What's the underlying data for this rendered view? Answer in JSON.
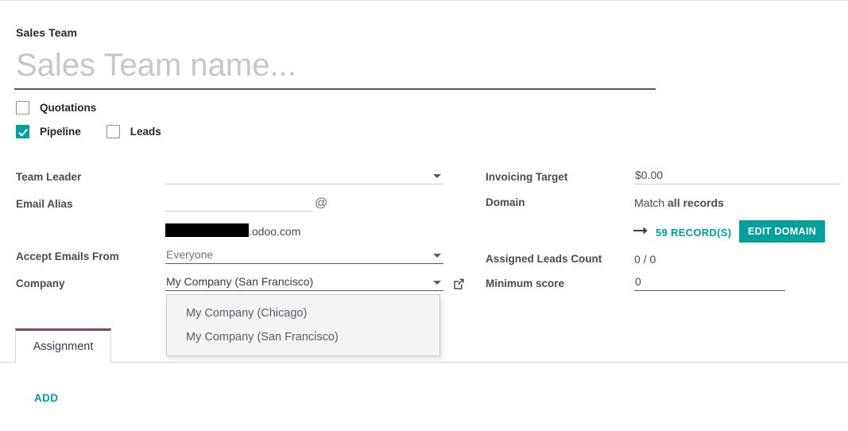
{
  "theme": {
    "accent_teal": "#00a09d",
    "brand_purple": "#714b67",
    "text": "#4c4c4c",
    "heading": "#23282d"
  },
  "form": {
    "title_label": "Sales Team",
    "name_placeholder": "Sales Team name...",
    "name_value": ""
  },
  "options": [
    {
      "label": "Quotations",
      "checked": false
    },
    {
      "label": "Pipeline",
      "checked": true
    },
    {
      "label": "Leads",
      "checked": false
    }
  ],
  "left_fields": {
    "team_leader": {
      "label": "Team Leader",
      "value": "",
      "placeholder": ""
    },
    "email_alias": {
      "label": "Email Alias",
      "value": "",
      "at_symbol": "@",
      "domain_suffix": ".odoo.com",
      "redacted": true
    },
    "accept_emails_from": {
      "label": "Accept Emails From",
      "value": "Everyone",
      "options": [
        "Everyone"
      ]
    },
    "company": {
      "label": "Company",
      "value": "My Company (San Francisco)",
      "suggestions": [
        "My Company (Chicago)",
        "My Company (San Francisco)"
      ]
    }
  },
  "right_fields": {
    "invoicing_target": {
      "label": "Invoicing Target",
      "value": "$0.00"
    },
    "domain": {
      "label": "Domain",
      "match_prefix": "Match ",
      "match_strong": "all records",
      "records_link": "59 RECORD(S)",
      "edit_button": "EDIT DOMAIN"
    },
    "assigned_leads_count": {
      "label": "Assigned Leads Count",
      "value": "0 / 0"
    },
    "minimum_score": {
      "label": "Minimum score",
      "value": "0"
    }
  },
  "notebook": {
    "tabs": [
      {
        "label": "Assignment",
        "active": true
      }
    ],
    "add_label": "ADD"
  }
}
